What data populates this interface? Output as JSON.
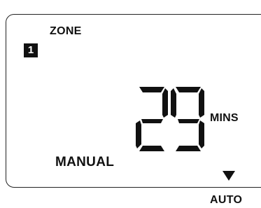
{
  "display": {
    "zone_label": "ZONE",
    "zone_number": "1",
    "minutes_value": "29",
    "minutes_unit": "MINS",
    "mode_label": "MANUAL",
    "mode_indicator_icon": "down-triangle",
    "auto_label": "AUTO"
  },
  "colors": {
    "segment": "#111111",
    "background": "#ffffff",
    "border": "#222222"
  }
}
